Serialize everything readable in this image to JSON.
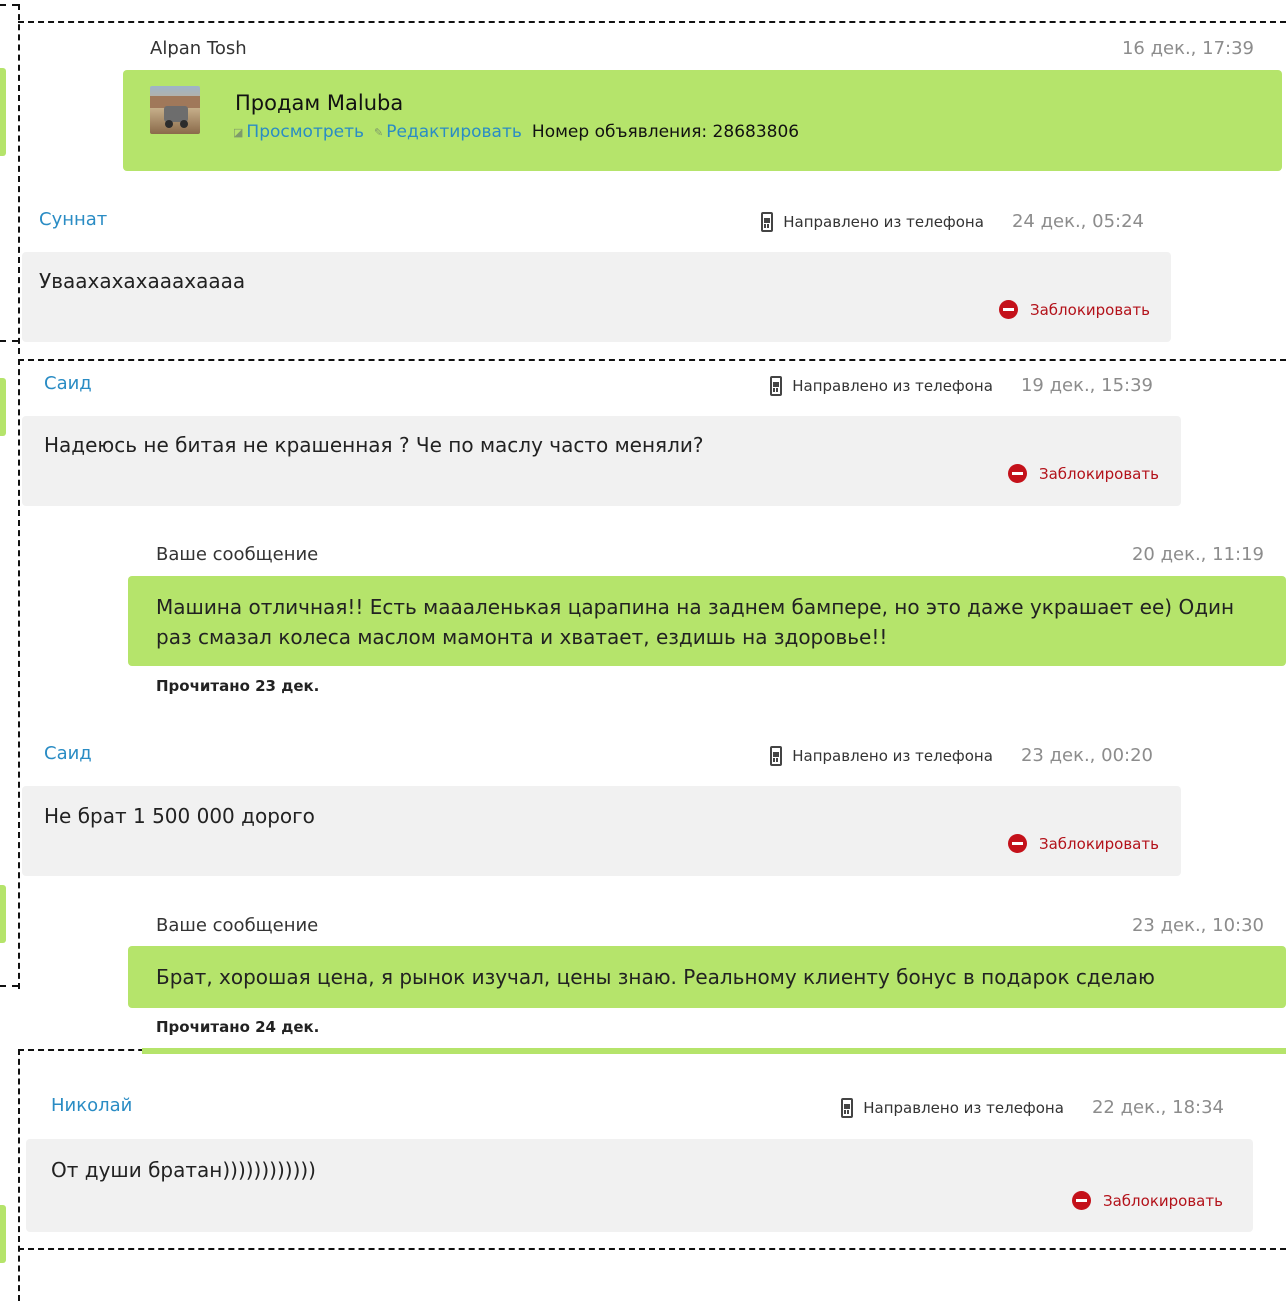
{
  "ad": {
    "author": "Alpan Tosh",
    "date": "16 дек., 17:39",
    "title": "Продам Maluba",
    "view_label": "Просмотреть",
    "edit_label": "Редактировать",
    "number_text": "Номер объявления: 28683806",
    "thumb_icon": "car-photo"
  },
  "phone_meta": "Направлено из телефона",
  "block_label": "Заблокировать",
  "messages": [
    {
      "author": "Суннат",
      "date": "24 дек., 05:24",
      "text": "Уваахахахааахаааа"
    },
    {
      "author": "Саид",
      "date": "19 дек., 15:39",
      "text": "Надеюсь не битая не крашенная ? Че по маслу часто меняли?"
    },
    {
      "author": "Ваше сообщение",
      "date": "20 дек., 11:19",
      "text": "Машина отличная!! Есть маааленькая царапина на заднем бампере, но это даже украшает ее) Один раз смазал колеса маслом мамонта и хватает, ездишь на здоровье!!",
      "read": "Прочитано 23 дек."
    },
    {
      "author": "Саид",
      "date": "23 дек., 00:20",
      "text": "Не брат 1 500 000 дорого"
    },
    {
      "author": "Ваше сообщение",
      "date": "23 дек., 10:30",
      "text": "Брат, хорошая цена, я рынок изучал, цены знаю. Реальному клиенту бонус в подарок сделаю",
      "read": "Прочитано 24 дек."
    },
    {
      "author": "Николай",
      "date": "22 дек., 18:34",
      "text": "От души братан))))))))))))"
    }
  ],
  "colors": {
    "green_bubble": "#b5e46b",
    "gray_bubble": "#f1f1f1",
    "link_blue": "#2a8cc4",
    "block_red": "#c4111a"
  }
}
